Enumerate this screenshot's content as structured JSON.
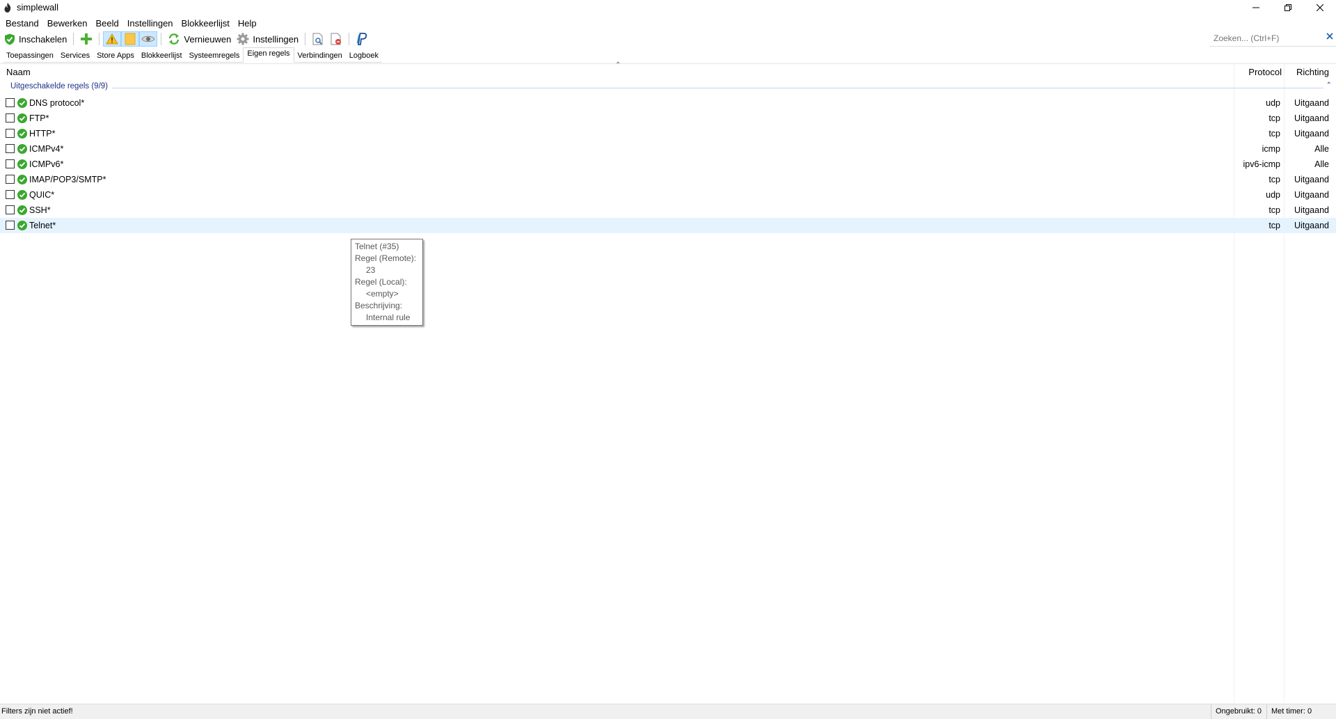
{
  "window": {
    "title": "simplewall",
    "app_icon": "flame-icon",
    "controls": [
      "minimize-icon",
      "restore-icon",
      "close-icon"
    ]
  },
  "menu": [
    "Bestand",
    "Bewerken",
    "Beeld",
    "Instellingen",
    "Blokkeerlijst",
    "Help"
  ],
  "toolbar": {
    "enable_label": "Inschakelen",
    "refresh_label": "Vernieuwen",
    "settings_label": "Instellingen",
    "icons": [
      "shield-check-icon",
      "add-icon",
      "warning-icon",
      "note-icon",
      "eye-icon",
      "refresh-icon",
      "gear-icon",
      "log-view-icon",
      "log-clear-icon",
      "donate-icon"
    ]
  },
  "search": {
    "placeholder": "Zoeken... (Ctrl+F)"
  },
  "tabs": [
    "Toepassingen",
    "Services",
    "Store Apps",
    "Blokkeerlijst",
    "Systeemregels",
    "Eigen regels",
    "Verbindingen",
    "Logboek"
  ],
  "active_tab": "Eigen regels",
  "columns": {
    "name": "Naam",
    "protocol": "Protocol",
    "direction": "Richting"
  },
  "group": {
    "label": "Uitgeschakelde regels (9/9)"
  },
  "rules": [
    {
      "name": "DNS protocol*",
      "protocol": "udp",
      "direction": "Uitgaand"
    },
    {
      "name": "FTP*",
      "protocol": "tcp",
      "direction": "Uitgaand"
    },
    {
      "name": "HTTP*",
      "protocol": "tcp",
      "direction": "Uitgaand"
    },
    {
      "name": "ICMPv4*",
      "protocol": "icmp",
      "direction": "Alle"
    },
    {
      "name": "ICMPv6*",
      "protocol": "ipv6-icmp",
      "direction": "Alle"
    },
    {
      "name": "IMAP/POP3/SMTP*",
      "protocol": "tcp",
      "direction": "Uitgaand"
    },
    {
      "name": "QUIC*",
      "protocol": "udp",
      "direction": "Uitgaand"
    },
    {
      "name": "SSH*",
      "protocol": "tcp",
      "direction": "Uitgaand"
    },
    {
      "name": "Telnet*",
      "protocol": "tcp",
      "direction": "Uitgaand"
    }
  ],
  "tooltip": {
    "title": "Telnet (#35)",
    "remote_label": "Regel (Remote):",
    "remote_value": "23",
    "local_label": "Regel (Local):",
    "local_value": "<empty>",
    "desc_label": "Beschrijving:",
    "desc_value": "Internal rule"
  },
  "statusbar": {
    "left": "Filters zijn niet actief!",
    "unused": "Ongebruikt: 0",
    "timer": "Met timer: 0"
  },
  "colors": {
    "accent_green": "#3aa82e",
    "group_text": "#1e3287",
    "selection": "#e5f3ff"
  }
}
